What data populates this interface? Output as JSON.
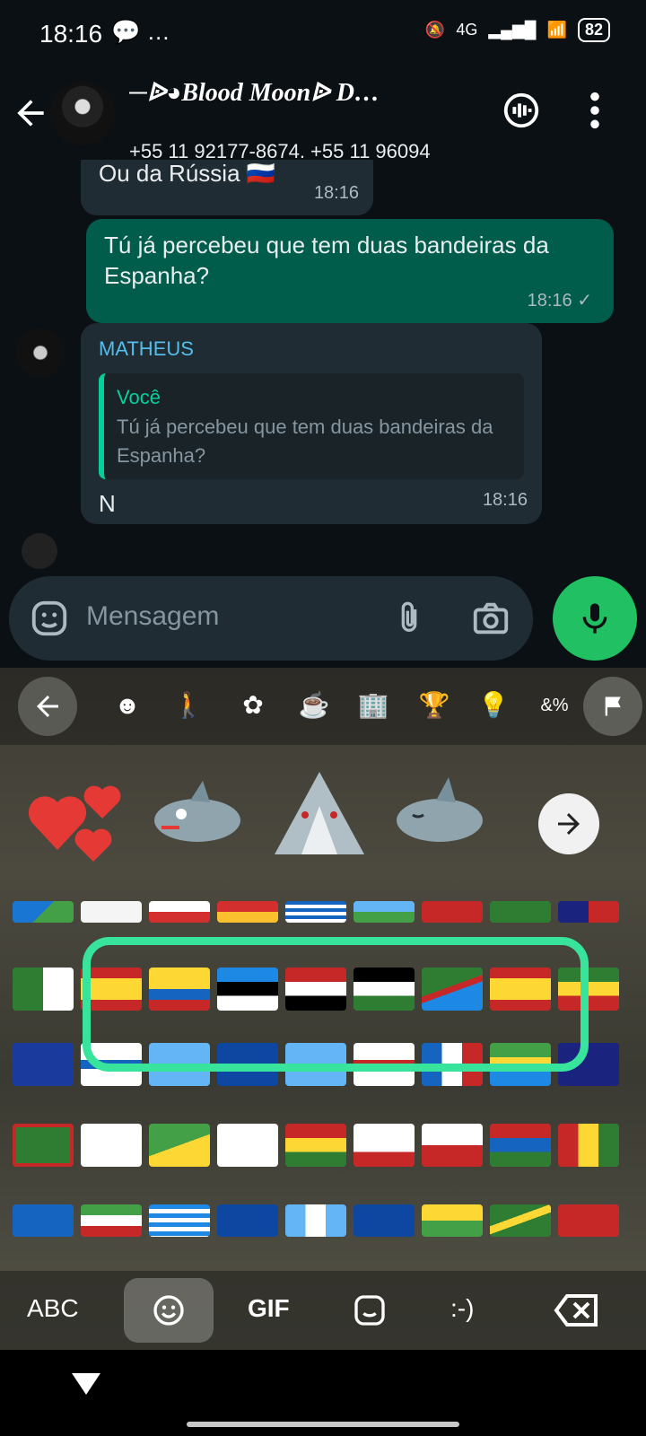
{
  "status_bar": {
    "time": "18:16",
    "extra": "…",
    "network": "4G",
    "battery": "82"
  },
  "header": {
    "title": "─ᐉ◕Blood Moonᐉ D…",
    "subtitle": "+55 11 92177-8674, +55 11 96094"
  },
  "messages": [
    {
      "type": "in",
      "text": "Ou da Rússia 🇷🇺",
      "time": "18:16"
    },
    {
      "type": "out",
      "text": "Tú já percebeu que tem duas bandeiras da Espanha?",
      "time": "18:16"
    },
    {
      "type": "in",
      "sender": "MATHEUS",
      "quote_name": "Você",
      "quote_text": "Tú já percebeu que tem duas bandeiras da Espanha?",
      "text": "N",
      "time": "18:16"
    }
  ],
  "composer": {
    "placeholder": "Mensagem"
  },
  "keyboard": {
    "categories": [
      "smiley-icon",
      "person-icon",
      "animal-icon",
      "food-icon",
      "travel-icon",
      "activity-icon",
      "objects-icon",
      "symbols-icon",
      "flags-icon"
    ],
    "bottom_bar": {
      "abc": "ABC",
      "gif": "GIF",
      "emoticon": ":-)"
    }
  },
  "flags": [
    [
      "Christmas Island",
      "Cyprus",
      "Czechia",
      "Germany",
      "Djibouti",
      "Denmark",
      "Dominica",
      "Dominican Republic"
    ],
    [
      "Algeria",
      "Spain",
      "Ecuador",
      "Estonia",
      "Egypt",
      "Western Sahara",
      "Eritrea",
      "Spain",
      "Ethiopia"
    ],
    [
      "European Union",
      "Finland",
      "Fiji",
      "Falkland Islands",
      "Micronesia",
      "Faroe Islands",
      "France",
      "Gabon",
      "United Kingdom"
    ],
    [
      "Grenada",
      "Georgia",
      "French Guiana",
      "Guernsey",
      "Ghana",
      "Gibraltar",
      "Greenland",
      "Gambia",
      "Guinea"
    ],
    [
      "Guadeloupe",
      "Equatorial Guinea",
      "Greece",
      "South Georgia",
      "Guatemala",
      "Guam",
      "Guinea-Bissau",
      "Guyana",
      "Hong Kong"
    ]
  ]
}
